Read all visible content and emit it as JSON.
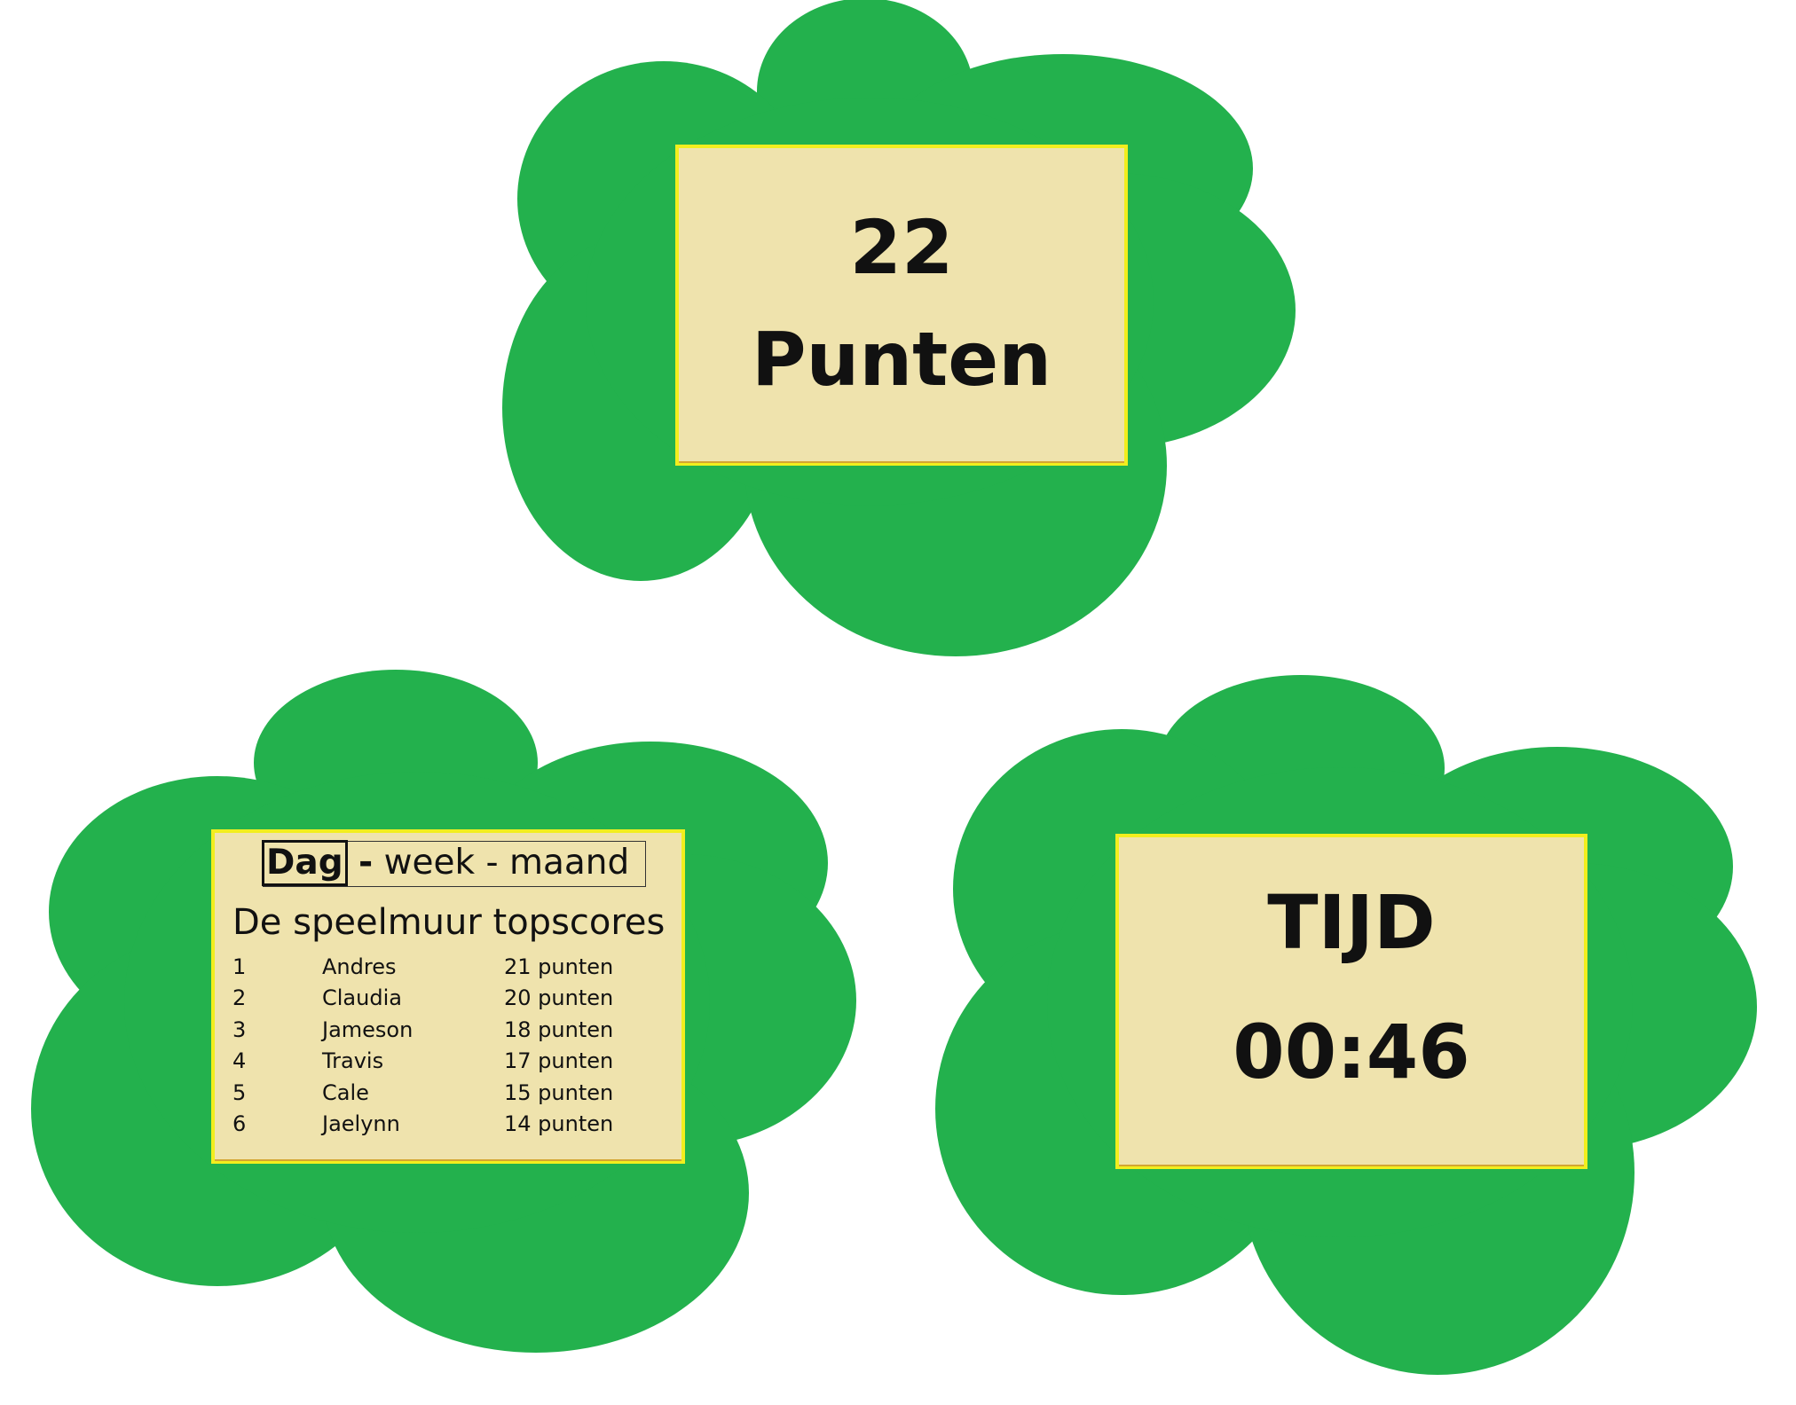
{
  "score": {
    "value": "22",
    "label": "Punten"
  },
  "timer": {
    "label": "TIJD",
    "value": "00:46"
  },
  "leaderboard": {
    "periods": {
      "active": "Dag",
      "separator_1": "-",
      "week": "week",
      "separator_2": "-",
      "month": "maand"
    },
    "title": "De speelmuur topscores",
    "rows": [
      {
        "rank": "1",
        "name": "Andres",
        "score": "21 punten"
      },
      {
        "rank": "2",
        "name": "Claudia",
        "score": "20 punten"
      },
      {
        "rank": "3",
        "name": "Jameson",
        "score": "18 punten"
      },
      {
        "rank": "4",
        "name": "Travis",
        "score": "17 punten"
      },
      {
        "rank": "5",
        "name": "Cale",
        "score": "15 punten"
      },
      {
        "rank": "6",
        "name": "Jaelynn",
        "score": "14 punten"
      }
    ]
  },
  "colors": {
    "cloud": "#23b14d",
    "panel": "#efe3ad",
    "panel_border": "#f2ee1e",
    "text": "#111111"
  }
}
